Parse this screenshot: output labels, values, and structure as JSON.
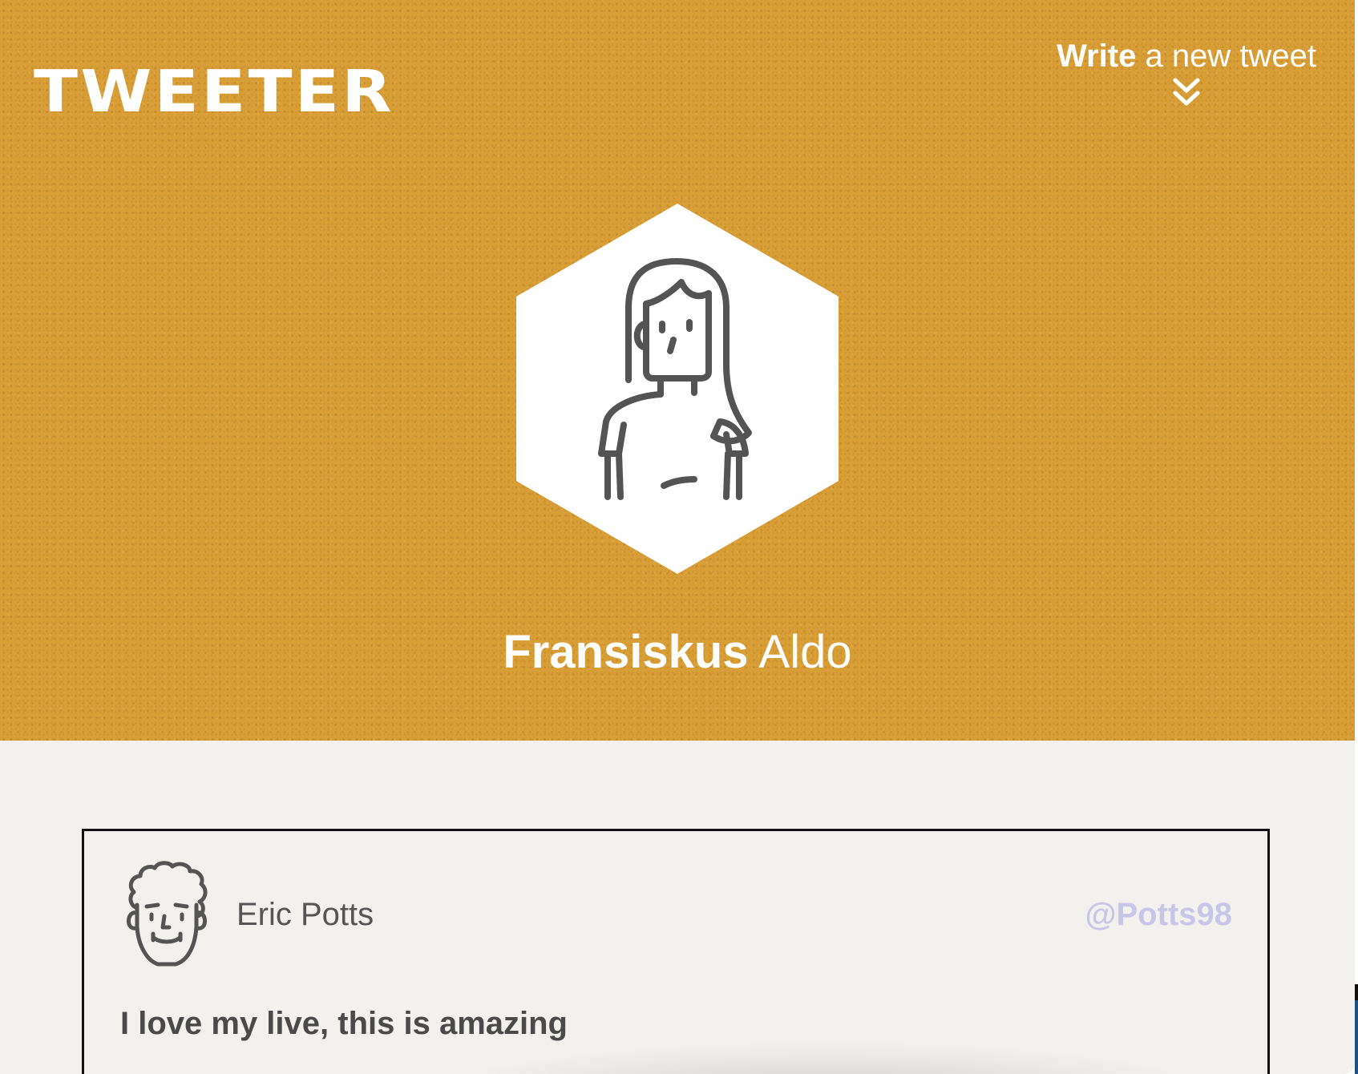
{
  "brand": {
    "name": "TWEETER"
  },
  "compose": {
    "label_strong": "Write",
    "label_light": "a new tweet",
    "icon": "double-chevron-down-icon"
  },
  "profile": {
    "first_name": "Fransiskus",
    "last_name": "Aldo",
    "avatar_icon": "woman-avatar-icon"
  },
  "tweets": [
    {
      "author": "Eric Potts",
      "handle": "@Potts98",
      "body": "I love my live, this is amazing",
      "avatar_icon": "man-curly-hair-avatar-icon"
    }
  ],
  "colors": {
    "header_background": "#d99e36",
    "page_background": "#f2f1ed",
    "handle": "#c8c6e8",
    "text": "#4a4a4a",
    "icon_stroke": "#545454"
  }
}
